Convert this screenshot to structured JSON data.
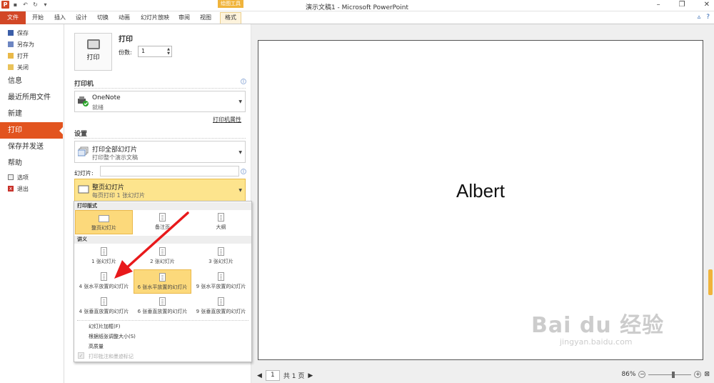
{
  "window": {
    "title": "演示文稿1 - Microsoft PowerPoint",
    "context_tab_group": "绘图工具"
  },
  "tabs": [
    "文件",
    "开始",
    "插入",
    "设计",
    "切换",
    "动画",
    "幻灯片放映",
    "审阅",
    "视图",
    "格式"
  ],
  "nav": {
    "small_top": [
      {
        "label": "保存",
        "icon": "save-icon"
      },
      {
        "label": "另存为",
        "icon": "save-as-icon"
      },
      {
        "label": "打开",
        "icon": "folder-icon"
      },
      {
        "label": "关闭",
        "icon": "close-file-icon"
      }
    ],
    "big": [
      {
        "label": "信息",
        "active": false
      },
      {
        "label": "最近所用文件",
        "active": false
      },
      {
        "label": "新建",
        "active": false
      },
      {
        "label": "打印",
        "active": true
      },
      {
        "label": "保存并发送",
        "active": false
      },
      {
        "label": "帮助",
        "active": false
      }
    ],
    "small_bottom": [
      {
        "label": "选项",
        "icon": "options-icon"
      },
      {
        "label": "退出",
        "icon": "exit-icon"
      }
    ]
  },
  "print": {
    "heading": "打印",
    "button_label": "打印",
    "copies_label": "份数:",
    "copies_value": "1"
  },
  "printer": {
    "section_title": "打印机",
    "name": "OneNote",
    "status": "就绪",
    "properties_link": "打印机属性"
  },
  "settings": {
    "section_title": "设置",
    "range_line1": "打印全部幻灯片",
    "range_line2": "打印整个演示文稿",
    "slides_label": "幻灯片:",
    "slides_value": "",
    "layout_line1": "整页幻灯片",
    "layout_line2": "每页打印 1 张幻灯片"
  },
  "layout_panel": {
    "print_layout_header": "打印版式",
    "print_layouts": [
      "整页幻灯片",
      "备注页",
      "大纲"
    ],
    "handouts_header": "讲义",
    "handouts": [
      "1 张幻灯片",
      "2 张幻灯片",
      "3 张幻灯片",
      "4 张水平放置的幻灯片",
      "6 张水平放置的幻灯片",
      "9 张水平放置的幻灯片",
      "4 张垂直放置的幻灯片",
      "6 张垂直放置的幻灯片",
      "9 张垂直放置的幻灯片"
    ],
    "options": [
      "幻灯片加框(F)",
      "根据纸张调整大小(S)",
      "高质量",
      "打印批注和墨迹标记"
    ]
  },
  "preview": {
    "slide_text": "Albert",
    "page_value": "1",
    "page_total": "共 1 页",
    "zoom": "86%"
  },
  "watermark": {
    "brand": "Bai du 经验",
    "url": "jingyan.baidu.com"
  },
  "colors": {
    "accent": "#d24726",
    "selection": "#fcd97b"
  }
}
